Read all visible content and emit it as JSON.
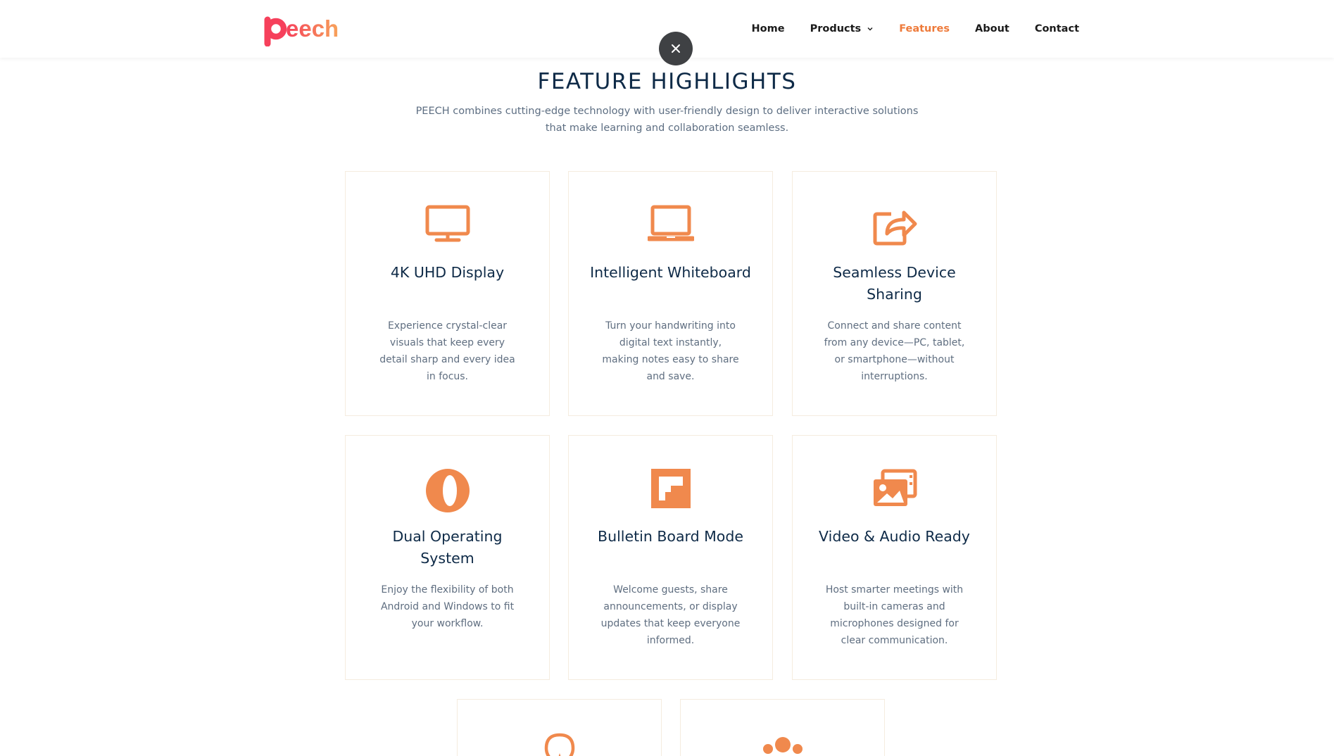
{
  "brand": {
    "logo_text": "Peech",
    "accent_color": "#ee7a3a",
    "logo_gradient": [
      "#f6405b",
      "#f7a35a"
    ]
  },
  "nav": {
    "home": "Home",
    "products": "Products",
    "features": "Features",
    "about": "About",
    "contact": "Contact",
    "active": "Features"
  },
  "hero": {
    "title": "FEATURE HIGHLIGHTS",
    "subtitle": "PEECH combines cutting-edge technology with user-friendly design to deliver interactive solutions that make learning and collaboration seamless."
  },
  "features": [
    {
      "icon": "monitor-icon",
      "title": "4K UHD Display",
      "description": "Experience crystal-clear visuals that keep every detail sharp and every idea in focus."
    },
    {
      "icon": "laptop-icon",
      "title": "Intelligent Whiteboard",
      "description": "Turn your handwriting into digital text instantly, making notes easy to share and save."
    },
    {
      "icon": "share-icon",
      "title": "Seamless Device Sharing",
      "description": "Connect and share content from any device—PC, tablet, or smartphone—without interruptions."
    },
    {
      "icon": "opera-icon",
      "title": "Dual Operating System",
      "description": "Enjoy the flexibility of both Android and Windows to fit your workflow."
    },
    {
      "icon": "flipboard-icon",
      "title": "Bulletin Board Mode",
      "description": "Welcome guests, share announcements, or display updates that keep everyone informed."
    },
    {
      "icon": "images-icon",
      "title": "Video & Audio Ready",
      "description": "Host smarter meetings with built-in cameras and microphones designed for clear communication."
    },
    {
      "icon": "lightbulb-icon",
      "title": "",
      "description": ""
    },
    {
      "icon": "users-icon",
      "title": "",
      "description": ""
    }
  ]
}
